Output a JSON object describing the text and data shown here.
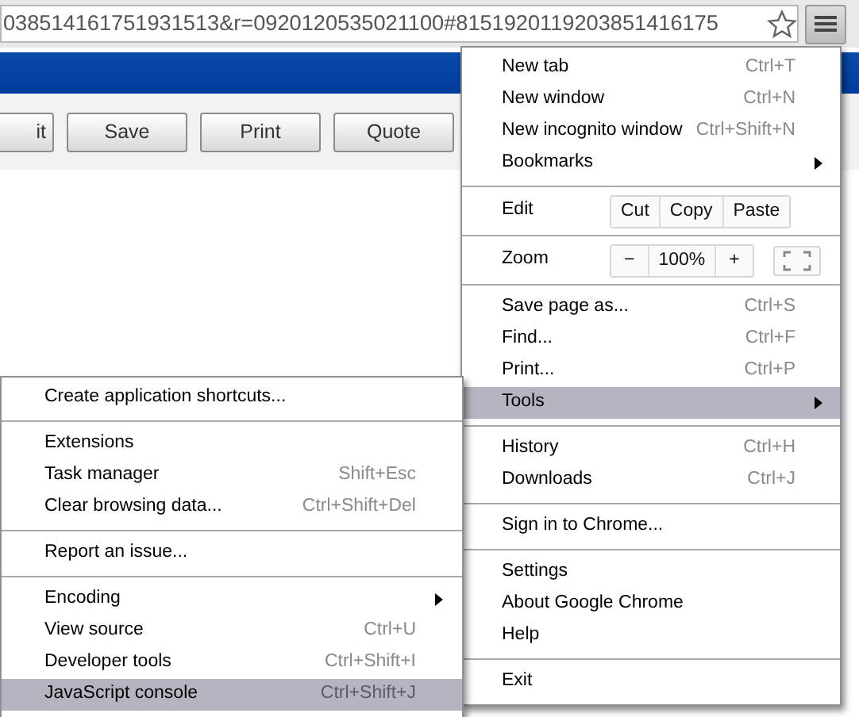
{
  "address_bar": {
    "url": "038514161751931513&r=0920120535021100#8151920119203851416175"
  },
  "toolbar_buttons": [
    "it",
    "Save",
    "Print",
    "Quote"
  ],
  "menu": [
    {
      "kind": "item",
      "label": "New tab",
      "shortcut": "Ctrl+T",
      "submenu": false,
      "selected": false
    },
    {
      "kind": "item",
      "label": "New window",
      "shortcut": "Ctrl+N",
      "submenu": false,
      "selected": false
    },
    {
      "kind": "item",
      "label": "New incognito window",
      "shortcut": "Ctrl+Shift+N",
      "submenu": false,
      "selected": false
    },
    {
      "kind": "item",
      "label": "Bookmarks",
      "submenu": true,
      "selected": false
    },
    {
      "kind": "separator"
    },
    {
      "kind": "edit",
      "label": "Edit",
      "buttons": [
        "Cut",
        "Copy",
        "Paste"
      ]
    },
    {
      "kind": "separator"
    },
    {
      "kind": "zoom",
      "label": "Zoom",
      "minus": "−",
      "value": "100%",
      "plus": "+"
    },
    {
      "kind": "separator"
    },
    {
      "kind": "item",
      "label": "Save page as...",
      "shortcut": "Ctrl+S",
      "submenu": false,
      "selected": false
    },
    {
      "kind": "item",
      "label": "Find...",
      "shortcut": "Ctrl+F",
      "submenu": false,
      "selected": false
    },
    {
      "kind": "item",
      "label": "Print...",
      "shortcut": "Ctrl+P",
      "submenu": false,
      "selected": false
    },
    {
      "kind": "item",
      "label": "Tools",
      "submenu": true,
      "selected": true
    },
    {
      "kind": "separator"
    },
    {
      "kind": "item",
      "label": "History",
      "shortcut": "Ctrl+H",
      "submenu": false,
      "selected": false
    },
    {
      "kind": "item",
      "label": "Downloads",
      "shortcut": "Ctrl+J",
      "submenu": false,
      "selected": false
    },
    {
      "kind": "separator"
    },
    {
      "kind": "item",
      "label": "Sign in to Chrome...",
      "submenu": false,
      "selected": false
    },
    {
      "kind": "separator"
    },
    {
      "kind": "item",
      "label": "Settings",
      "submenu": false,
      "selected": false
    },
    {
      "kind": "item",
      "label": "About Google Chrome",
      "submenu": false,
      "selected": false
    },
    {
      "kind": "item",
      "label": "Help",
      "submenu": false,
      "selected": false
    },
    {
      "kind": "separator"
    },
    {
      "kind": "item",
      "label": "Exit",
      "submenu": false,
      "selected": false
    }
  ],
  "tools_submenu": [
    {
      "kind": "item",
      "label": "Create application shortcuts...",
      "submenu": false,
      "selected": false
    },
    {
      "kind": "separator"
    },
    {
      "kind": "item",
      "label": "Extensions",
      "submenu": false,
      "selected": false
    },
    {
      "kind": "item",
      "label": "Task manager",
      "shortcut": "Shift+Esc",
      "submenu": false,
      "selected": false
    },
    {
      "kind": "item",
      "label": "Clear browsing data...",
      "shortcut": "Ctrl+Shift+Del",
      "submenu": false,
      "selected": false
    },
    {
      "kind": "separator"
    },
    {
      "kind": "item",
      "label": "Report an issue...",
      "submenu": false,
      "selected": false
    },
    {
      "kind": "separator"
    },
    {
      "kind": "item",
      "label": "Encoding",
      "submenu": true,
      "selected": false
    },
    {
      "kind": "item",
      "label": "View source",
      "shortcut": "Ctrl+U",
      "submenu": false,
      "selected": false
    },
    {
      "kind": "item",
      "label": "Developer tools",
      "shortcut": "Ctrl+Shift+I",
      "submenu": false,
      "selected": false
    },
    {
      "kind": "item",
      "label": "JavaScript console",
      "shortcut": "Ctrl+Shift+J",
      "submenu": false,
      "selected": true
    }
  ]
}
